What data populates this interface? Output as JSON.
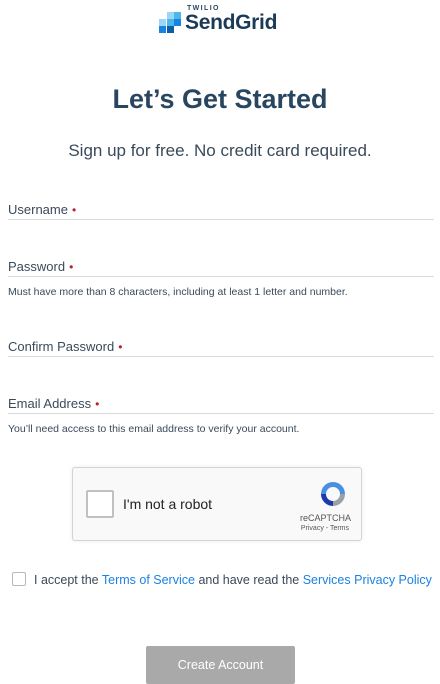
{
  "brand": {
    "top_text": "TWILIO",
    "name": "SendGrid",
    "mark_colors": [
      "#9dd6f5",
      "#4bb8ec",
      "#1a82e2",
      "#0c5ea8"
    ]
  },
  "page": {
    "title": "Let’s Get Started",
    "subtitle": "Sign up for free. No credit card required."
  },
  "form": {
    "username": {
      "label": "Username",
      "required_mark": "•"
    },
    "password": {
      "label": "Password",
      "required_mark": "•",
      "hint": "Must have more than 8 characters, including at least 1 letter and number."
    },
    "confirm_password": {
      "label": "Confirm Password",
      "required_mark": "•"
    },
    "email": {
      "label": "Email Address",
      "required_mark": "•",
      "hint": "You’ll need access to this email address to verify your account."
    }
  },
  "captcha": {
    "label": "I'm not a robot",
    "brand": "reCAPTCHA",
    "privacy": "Privacy",
    "separator": " - ",
    "terms": "Terms"
  },
  "consent": {
    "prefix": "I accept the ",
    "terms_link": "Terms of Service",
    "middle": " and have read the ",
    "privacy_link": "Services Privacy Policy"
  },
  "submit": {
    "label": "Create Account",
    "color": "#a9a9a9"
  },
  "colors": {
    "link": "#1a82e2",
    "required": "#b3232d",
    "heading": "#294661"
  }
}
